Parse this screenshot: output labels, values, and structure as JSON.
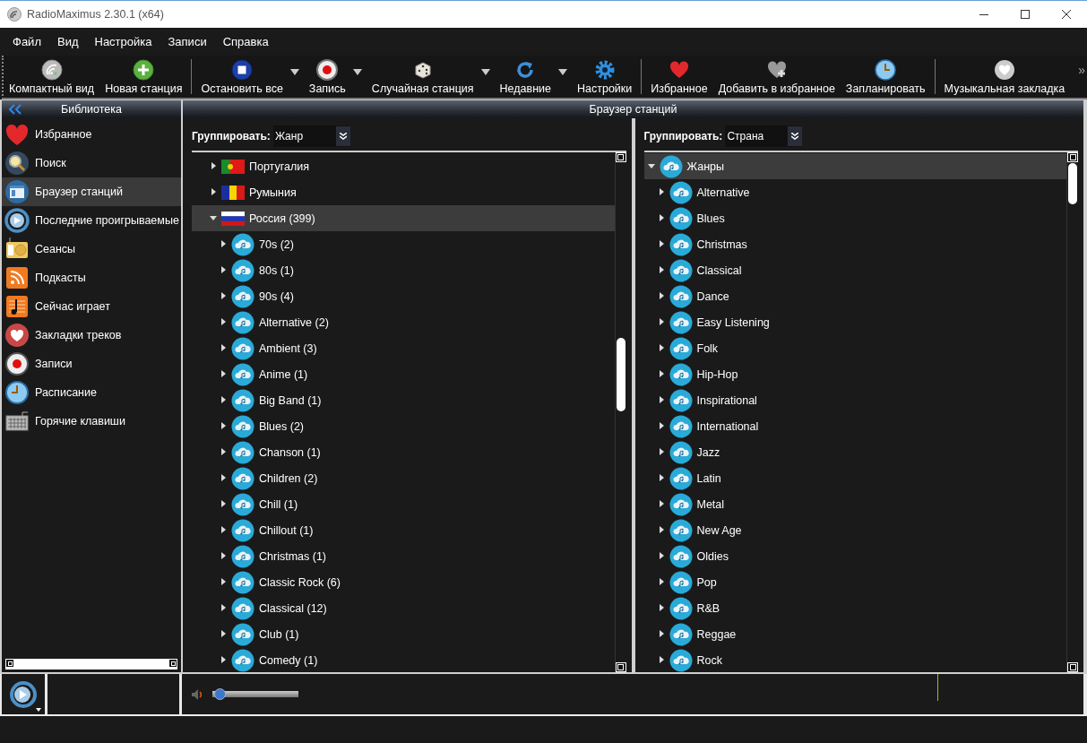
{
  "window": {
    "title": "RadioMaximus 2.30.1 (x64)"
  },
  "menu": [
    "Файл",
    "Вид",
    "Настройка",
    "Записи",
    "Справка"
  ],
  "toolbar": {
    "groups": [
      [
        {
          "label": "Компактный вид",
          "has_menu": false
        },
        {
          "label": "Новая станция",
          "has_menu": false
        }
      ],
      [
        {
          "label": "Остановить все",
          "has_menu": true
        },
        {
          "label": "Запись",
          "has_menu": true
        },
        {
          "label": "Случайная станция",
          "has_menu": true
        },
        {
          "label": "Недавние",
          "has_menu": true
        },
        {
          "label": "Настройки",
          "has_menu": false
        }
      ],
      [
        {
          "label": "Избранное",
          "has_menu": false
        },
        {
          "label": "Добавить в избранное",
          "has_menu": false
        },
        {
          "label": "Запланировать",
          "has_menu": false
        }
      ],
      [
        {
          "label": "Музыкальная закладка",
          "has_menu": false
        }
      ]
    ],
    "overflow": "»"
  },
  "library": {
    "title": "Библиотека",
    "items": [
      {
        "label": "Избранное",
        "selected": false
      },
      {
        "label": "Поиск",
        "selected": false
      },
      {
        "label": "Браузер станций",
        "selected": true
      },
      {
        "label": "Последние проигрываемые",
        "selected": false
      },
      {
        "label": "Сеансы",
        "selected": false
      },
      {
        "label": "Подкасты",
        "selected": false
      },
      {
        "label": "Сейчас играет",
        "selected": false
      },
      {
        "label": "Закладки треков",
        "selected": false
      },
      {
        "label": "Записи",
        "selected": false
      },
      {
        "label": "Расписание",
        "selected": false
      },
      {
        "label": "Горячие клавиши",
        "selected": false
      }
    ]
  },
  "browser": {
    "title": "Браузер станций",
    "panes": [
      {
        "group_label": "Группировать:",
        "group_value": "Жанр",
        "tree": [
          {
            "label": "Португалия",
            "kind": "country",
            "expanded": false,
            "selected": false
          },
          {
            "label": "Румыния",
            "kind": "country",
            "expanded": false,
            "selected": false
          },
          {
            "label": "Россия (399)",
            "kind": "country",
            "expanded": true,
            "selected": true,
            "children": [
              {
                "label": "70s (2)",
                "kind": "genre",
                "expanded": false,
                "selected": false
              },
              {
                "label": "80s (1)",
                "kind": "genre",
                "expanded": false,
                "selected": false
              },
              {
                "label": "90s (4)",
                "kind": "genre",
                "expanded": false,
                "selected": false
              },
              {
                "label": "Alternative (2)",
                "kind": "genre",
                "expanded": false,
                "selected": false
              },
              {
                "label": "Ambient (3)",
                "kind": "genre",
                "expanded": false,
                "selected": false
              },
              {
                "label": "Anime (1)",
                "kind": "genre",
                "expanded": false,
                "selected": false
              },
              {
                "label": "Big Band (1)",
                "kind": "genre",
                "expanded": false,
                "selected": false
              },
              {
                "label": "Blues (2)",
                "kind": "genre",
                "expanded": false,
                "selected": false
              },
              {
                "label": "Chanson (1)",
                "kind": "genre",
                "expanded": false,
                "selected": false
              },
              {
                "label": "Children (2)",
                "kind": "genre",
                "expanded": false,
                "selected": false
              },
              {
                "label": "Chill (1)",
                "kind": "genre",
                "expanded": false,
                "selected": false
              },
              {
                "label": "Chillout (1)",
                "kind": "genre",
                "expanded": false,
                "selected": false
              },
              {
                "label": "Christmas (1)",
                "kind": "genre",
                "expanded": false,
                "selected": false
              },
              {
                "label": "Classic Rock (6)",
                "kind": "genre",
                "expanded": false,
                "selected": false
              },
              {
                "label": "Classical (12)",
                "kind": "genre",
                "expanded": false,
                "selected": false
              },
              {
                "label": "Club (1)",
                "kind": "genre",
                "expanded": false,
                "selected": false
              },
              {
                "label": "Comedy (1)",
                "kind": "genre",
                "expanded": false,
                "selected": false
              }
            ]
          }
        ]
      },
      {
        "group_label": "Группировать:",
        "group_value": "Страна",
        "tree": [
          {
            "label": "Жанры",
            "kind": "genre",
            "expanded": true,
            "selected": true,
            "children": [
              {
                "label": "Alternative",
                "kind": "genre",
                "expanded": false,
                "selected": false
              },
              {
                "label": "Blues",
                "kind": "genre",
                "expanded": false,
                "selected": false
              },
              {
                "label": "Christmas",
                "kind": "genre",
                "expanded": false,
                "selected": false
              },
              {
                "label": "Classical",
                "kind": "genre",
                "expanded": false,
                "selected": false
              },
              {
                "label": "Dance",
                "kind": "genre",
                "expanded": false,
                "selected": false
              },
              {
                "label": "Easy Listening",
                "kind": "genre",
                "expanded": false,
                "selected": false
              },
              {
                "label": "Folk",
                "kind": "genre",
                "expanded": false,
                "selected": false
              },
              {
                "label": "Hip-Hop",
                "kind": "genre",
                "expanded": false,
                "selected": false
              },
              {
                "label": "Inspirational",
                "kind": "genre",
                "expanded": false,
                "selected": false
              },
              {
                "label": "International",
                "kind": "genre",
                "expanded": false,
                "selected": false
              },
              {
                "label": "Jazz",
                "kind": "genre",
                "expanded": false,
                "selected": false
              },
              {
                "label": "Latin",
                "kind": "genre",
                "expanded": false,
                "selected": false
              },
              {
                "label": "Metal",
                "kind": "genre",
                "expanded": false,
                "selected": false
              },
              {
                "label": "New Age",
                "kind": "genre",
                "expanded": false,
                "selected": false
              },
              {
                "label": "Oldies",
                "kind": "genre",
                "expanded": false,
                "selected": false
              },
              {
                "label": "Pop",
                "kind": "genre",
                "expanded": false,
                "selected": false
              },
              {
                "label": "R&B",
                "kind": "genre",
                "expanded": false,
                "selected": false
              },
              {
                "label": "Reggae",
                "kind": "genre",
                "expanded": false,
                "selected": false
              },
              {
                "label": "Rock",
                "kind": "genre",
                "expanded": false,
                "selected": false
              }
            ]
          }
        ]
      }
    ]
  },
  "player": {
    "volume": {
      "level": 0.02
    }
  }
}
